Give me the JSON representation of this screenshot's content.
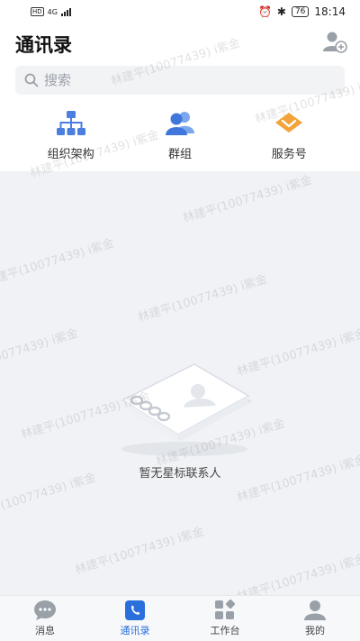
{
  "status_bar": {
    "left_tags": [
      "HD",
      "4G"
    ],
    "battery": "76",
    "time": "18:14"
  },
  "header": {
    "title": "通讯录",
    "search_placeholder": "搜索"
  },
  "quick_actions": [
    {
      "label": "组织架构",
      "icon": "org-chart-icon"
    },
    {
      "label": "群组",
      "icon": "group-icon"
    },
    {
      "label": "服务号",
      "icon": "service-icon"
    }
  ],
  "empty_state": {
    "message": "暂无星标联系人"
  },
  "watermark": {
    "text": "林建平(10077439) i紫金"
  },
  "bottom_nav": [
    {
      "label": "消息",
      "icon": "chat-icon",
      "active": false
    },
    {
      "label": "通讯录",
      "icon": "contacts-icon",
      "active": true
    },
    {
      "label": "工作台",
      "icon": "workbench-icon",
      "active": false
    },
    {
      "label": "我的",
      "icon": "profile-icon",
      "active": false
    }
  ],
  "colors": {
    "accent": "#2a6fdb",
    "icon_blue": "#4a7fe0",
    "icon_orange": "#f2a33a",
    "background": "#f0f2f5"
  }
}
